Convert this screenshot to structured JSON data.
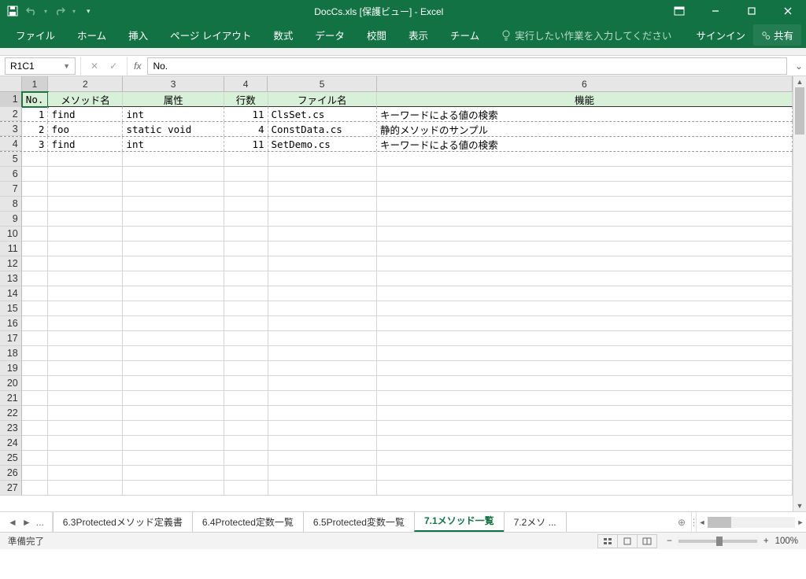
{
  "title": "DocCs.xls  [保護ビュー] - Excel",
  "qat": {
    "save": "save",
    "undo": "undo",
    "redo": "redo"
  },
  "wincontrols": {
    "ribbonopts": "ribbon-display-options"
  },
  "ribbon": {
    "tabs": [
      "ファイル",
      "ホーム",
      "挿入",
      "ページ レイアウト",
      "数式",
      "データ",
      "校閲",
      "表示",
      "チーム"
    ],
    "tellme": "実行したい作業を入力してください",
    "signin": "サインイン",
    "share": "共有"
  },
  "formula_bar": {
    "namebox": "R1C1",
    "fx": "fx",
    "value": "No."
  },
  "columns": [
    "1",
    "2",
    "3",
    "4",
    "5",
    "6"
  ],
  "headers": {
    "c1": "No.",
    "c2": "メソッド名",
    "c3": "属性",
    "c4": "行数",
    "c5": "ファイル名",
    "c6": "機能"
  },
  "rows": [
    {
      "no": "1",
      "method": "find",
      "attr": "int",
      "lines": "11",
      "file": "ClsSet.cs",
      "func": "キーワードによる値の検索"
    },
    {
      "no": "2",
      "method": "foo",
      "attr": "static void",
      "lines": "4",
      "file": "ConstData.cs",
      "func": "静的メソッドのサンプル"
    },
    {
      "no": "3",
      "method": "find",
      "attr": "int",
      "lines": "11",
      "file": "SetDemo.cs",
      "func": "キーワードによる値の検索"
    }
  ],
  "empty_row_count": 23,
  "sheets": {
    "ellipsis": "...",
    "tabs": [
      "6.3Protectedメソッド定義書",
      "6.4Protected定数一覧",
      "6.5Protected変数一覧",
      "7.1メソッド一覧",
      "7.2メソ ..."
    ],
    "active_index": 3
  },
  "status": {
    "ready": "準備完了",
    "zoom": "100%"
  }
}
